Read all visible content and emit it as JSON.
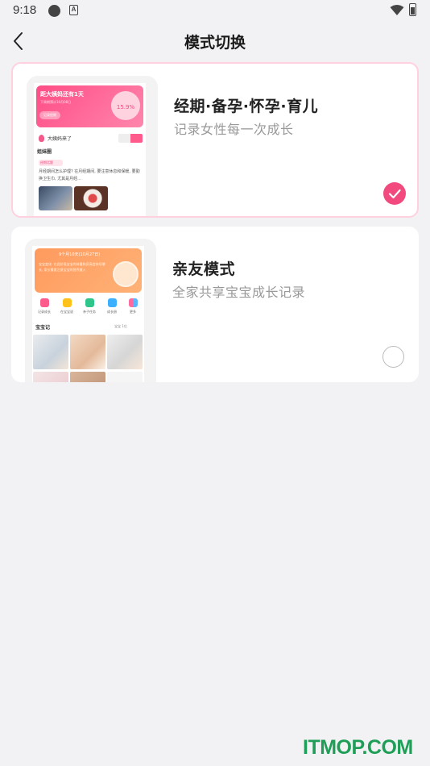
{
  "status_bar": {
    "time": "9:18"
  },
  "header": {
    "title": "模式切换"
  },
  "modes": [
    {
      "title": "经期·备孕·怀孕·育儿",
      "subtitle": "记录女性每一次成长",
      "selected": true,
      "preview": {
        "banner_title": "距大姨妈还有1天",
        "banner_sub": "下周期预计10月08日",
        "banner_btn": "记录经期",
        "flower_text": "15.9%",
        "row_text": "大姨妈来了",
        "section": "姐妹圈",
        "tag": "经期话题",
        "text": "月经期间怎么护理? 在月经期间, 要注意休息和保暖, 要勤换卫生巾, 尤其是月经..."
      }
    },
    {
      "title": "亲友模式",
      "subtitle": "全家共享宝宝成长记录",
      "selected": false,
      "preview": {
        "banner_title": "9个月10天(10月27日)",
        "banner_sub": "宝宝变化: 在此阶段宝宝的体重和身高会持续增长, 家长需要注意宝宝的营养摄入",
        "icons": [
          "记录成长",
          "在宝宝说",
          "亲子任务",
          "成长册",
          "更多"
        ],
        "section": "宝宝记",
        "section_right": "宝宝 1位"
      }
    }
  ],
  "watermark": "ITMOP.COM",
  "colors": {
    "accent": "#f24a7e",
    "watermark": "#1f9e57"
  }
}
